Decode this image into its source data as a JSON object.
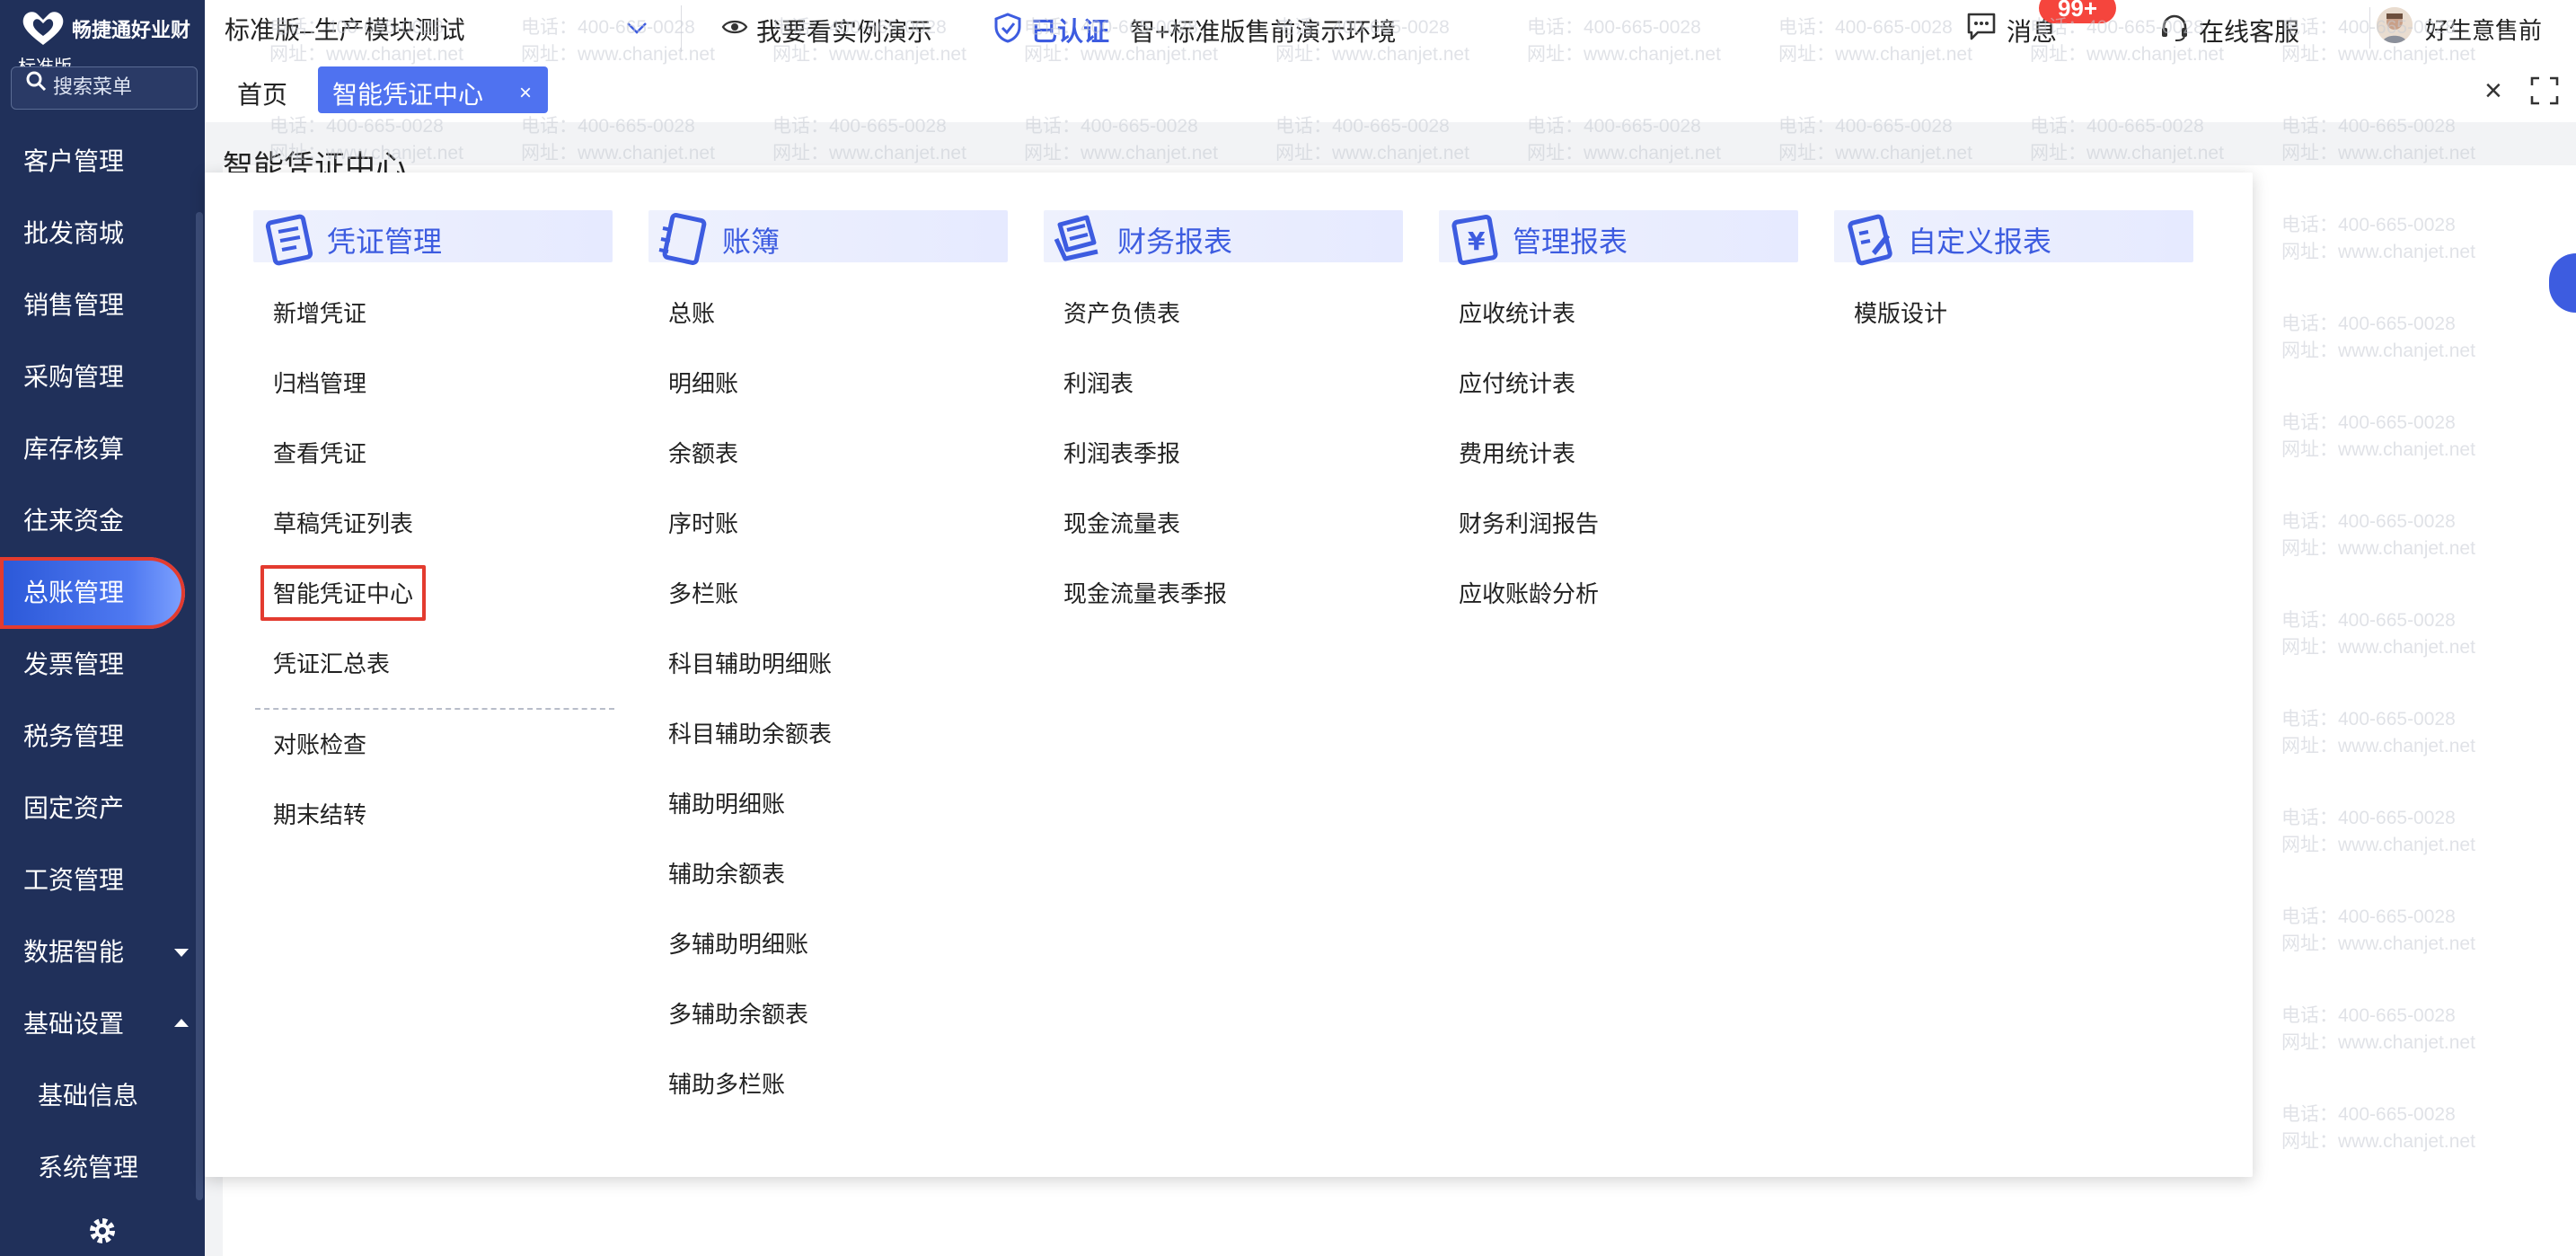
{
  "brand": {
    "name": "畅捷通好业财",
    "edition": "标准版"
  },
  "sidebar": {
    "search_placeholder": "搜索菜单",
    "items": [
      {
        "label": "客户管理"
      },
      {
        "label": "批发商城"
      },
      {
        "label": "销售管理"
      },
      {
        "label": "采购管理"
      },
      {
        "label": "库存核算"
      },
      {
        "label": "往来资金"
      },
      {
        "label": "总账管理",
        "active": true
      },
      {
        "label": "发票管理"
      },
      {
        "label": "税务管理"
      },
      {
        "label": "固定资产"
      },
      {
        "label": "工资管理"
      },
      {
        "label": "数据智能",
        "caret": "down"
      },
      {
        "label": "基础设置",
        "caret": "up"
      },
      {
        "label": "基础信息",
        "sub": true
      },
      {
        "label": "系统管理",
        "sub": true
      }
    ]
  },
  "topbar": {
    "company": "标准版–生产模块测试",
    "demo_link": "我要看实例演示",
    "certified": "已认证",
    "environment": "智+标准版售前演示环境",
    "messages_label": "消息",
    "messages_badge": "99+",
    "service_label": "在线客服",
    "user_name": "好生意售前"
  },
  "tabs": {
    "home": "首页",
    "active": "智能凭证中心",
    "close_symbol": "×"
  },
  "page": {
    "title": "智能凭证中心"
  },
  "watermark": {
    "phone": "电话：400-665-0028",
    "site": "网址：www.chanjet.net"
  },
  "menu_panel": {
    "columns": [
      {
        "title": "凭证管理",
        "icon": "voucher-icon",
        "items": [
          "新增凭证",
          "归档管理",
          "查看凭证",
          "草稿凭证列表",
          "智能凭证中心",
          "凭证汇总表",
          "对账检查",
          "期末结转"
        ],
        "highlight_index": 4,
        "separator_after_index": 5
      },
      {
        "title": "账簿",
        "icon": "ledger-icon",
        "items": [
          "总账",
          "明细账",
          "余额表",
          "序时账",
          "多栏账",
          "科目辅助明细账",
          "科目辅助余额表",
          "辅助明细账",
          "辅助余额表",
          "多辅助明细账",
          "多辅助余额表",
          "辅助多栏账"
        ]
      },
      {
        "title": "财务报表",
        "icon": "financial-report-icon",
        "items": [
          "资产负债表",
          "利润表",
          "利润表季报",
          "现金流量表",
          "现金流量表季报"
        ]
      },
      {
        "title": "管理报表",
        "icon": "management-report-icon",
        "items": [
          "应收统计表",
          "应付统计表",
          "费用统计表",
          "财务利润报告",
          "应收账龄分析"
        ]
      },
      {
        "title": "自定义报表",
        "icon": "custom-report-icon",
        "items": [
          "模版设计"
        ]
      }
    ]
  },
  "colors": {
    "sidebar_bg": "#20305a",
    "accent": "#3d5ce0",
    "tab_active": "#4f72f0",
    "highlight_border": "#e33b2f",
    "badge": "#f5453d"
  }
}
